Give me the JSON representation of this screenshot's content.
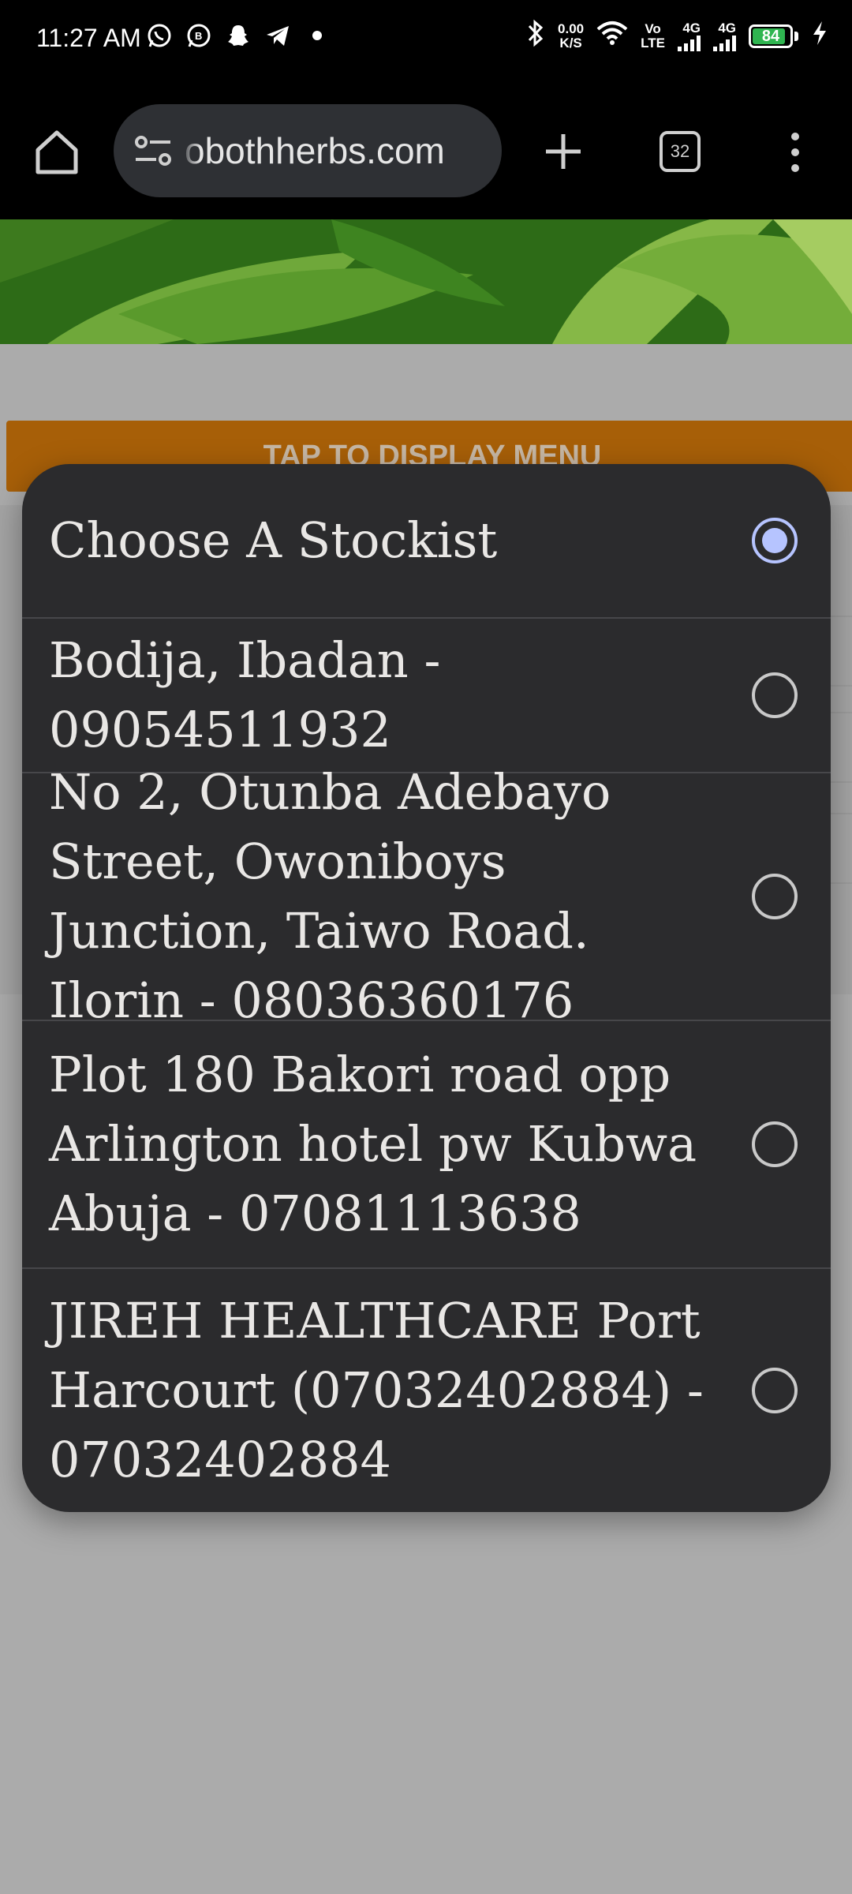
{
  "status_bar": {
    "time": "11:27 AM",
    "net_speed_value": "0.00",
    "net_speed_unit": "K/S",
    "volte_top": "Vo",
    "volte_bottom": "LTE",
    "sim1_label": "4G",
    "sim2_label": "4G",
    "battery_level": "84",
    "icons": [
      "whatsapp-icon",
      "whatsapp-business-icon",
      "snapchat-icon",
      "telegram-icon",
      "dot-icon",
      "bluetooth-icon",
      "wifi-icon",
      "charging-icon"
    ]
  },
  "browser": {
    "url": "obothherbs.com",
    "tab_count": "32"
  },
  "page": {
    "menu_button_label": "TAP TO DISPLAY MENU"
  },
  "dialog": {
    "options": [
      {
        "label": "Choose A Stockist",
        "selected": true
      },
      {
        "label": "Bodija, Ibadan - 09054511932",
        "selected": false
      },
      {
        "label": "No 2, Otunba Adebayo Street, Owoniboys Junction, Taiwo Road. Ilorin - 08036360176",
        "selected": false
      },
      {
        "label": "Plot 180 Bakori road opp Arlington hotel pw Kubwa Abuja - 07081113638",
        "selected": false
      },
      {
        "label": "JIREH HEALTHCARE Port Harcourt (07032402884) - 07032402884",
        "selected": false
      }
    ]
  },
  "colors": {
    "dialog_bg": "#2b2b2d",
    "radio_selected": "#b6c4ff",
    "menu_bar": "#a75f08",
    "battery_fill": "#2fb550"
  }
}
